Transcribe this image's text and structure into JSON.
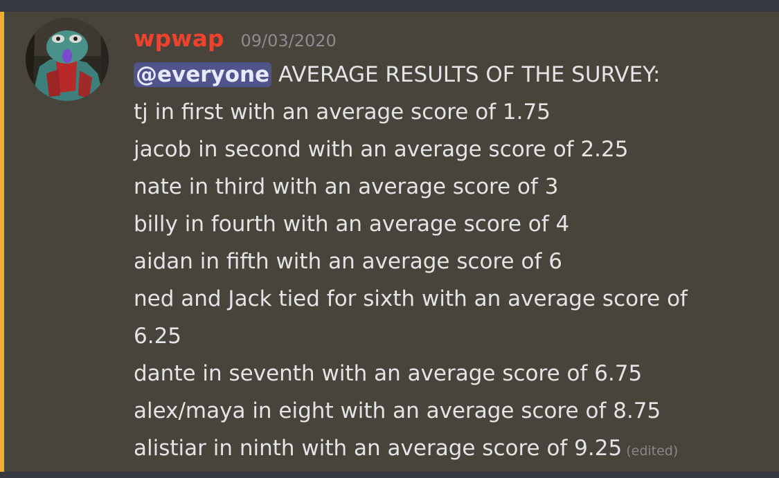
{
  "message": {
    "username": "wpwap",
    "timestamp": "09/03/2020",
    "mention": "@everyone",
    "headline": " AVERAGE RESULTS OF THE SURVEY:",
    "lines": [
      "tj in first with an average score of 1.75",
      "jacob in second with an average score of 2.25",
      "nate in third with an average score of 3",
      "billy in fourth with an average score of 4",
      "aidan in fifth with an average score of 6",
      "ned and Jack tied for sixth with an average score of",
      "6.25",
      "dante in seventh with an average score of 6.75",
      "alex/maya in eight with an average score of 8.75",
      "alistiar in ninth with an average score of 9.25"
    ],
    "edited_label": "(edited)"
  },
  "colors": {
    "background": "#36393f",
    "message_highlight": "#48443b",
    "highlight_border": "#f1ad2f",
    "username": "#f0412d",
    "mention_bg": "#50548a"
  },
  "icons": {
    "avatar": "user-avatar-image"
  }
}
